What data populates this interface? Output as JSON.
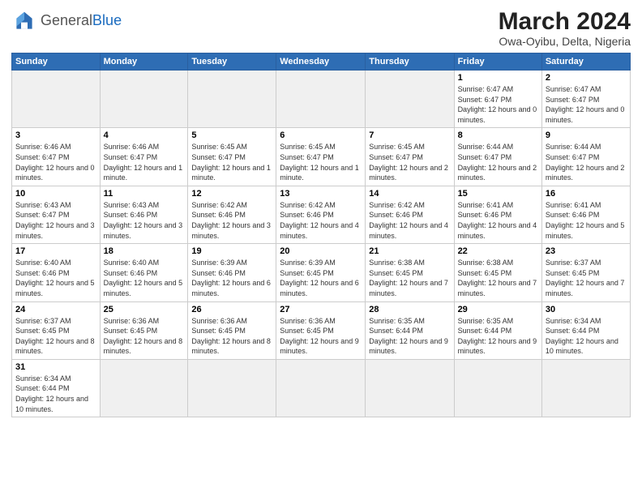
{
  "header": {
    "logo_general": "General",
    "logo_blue": "Blue",
    "month_year": "March 2024",
    "location": "Owa-Oyibu, Delta, Nigeria"
  },
  "weekdays": [
    "Sunday",
    "Monday",
    "Tuesday",
    "Wednesday",
    "Thursday",
    "Friday",
    "Saturday"
  ],
  "weeks": [
    [
      {
        "day": "",
        "info": "",
        "empty": true
      },
      {
        "day": "",
        "info": "",
        "empty": true
      },
      {
        "day": "",
        "info": "",
        "empty": true
      },
      {
        "day": "",
        "info": "",
        "empty": true
      },
      {
        "day": "",
        "info": "",
        "empty": true
      },
      {
        "day": "1",
        "info": "Sunrise: 6:47 AM\nSunset: 6:47 PM\nDaylight: 12 hours and 0 minutes.",
        "empty": false
      },
      {
        "day": "2",
        "info": "Sunrise: 6:47 AM\nSunset: 6:47 PM\nDaylight: 12 hours and 0 minutes.",
        "empty": false
      }
    ],
    [
      {
        "day": "3",
        "info": "Sunrise: 6:46 AM\nSunset: 6:47 PM\nDaylight: 12 hours and 0 minutes.",
        "empty": false
      },
      {
        "day": "4",
        "info": "Sunrise: 6:46 AM\nSunset: 6:47 PM\nDaylight: 12 hours and 1 minute.",
        "empty": false
      },
      {
        "day": "5",
        "info": "Sunrise: 6:45 AM\nSunset: 6:47 PM\nDaylight: 12 hours and 1 minute.",
        "empty": false
      },
      {
        "day": "6",
        "info": "Sunrise: 6:45 AM\nSunset: 6:47 PM\nDaylight: 12 hours and 1 minute.",
        "empty": false
      },
      {
        "day": "7",
        "info": "Sunrise: 6:45 AM\nSunset: 6:47 PM\nDaylight: 12 hours and 2 minutes.",
        "empty": false
      },
      {
        "day": "8",
        "info": "Sunrise: 6:44 AM\nSunset: 6:47 PM\nDaylight: 12 hours and 2 minutes.",
        "empty": false
      },
      {
        "day": "9",
        "info": "Sunrise: 6:44 AM\nSunset: 6:47 PM\nDaylight: 12 hours and 2 minutes.",
        "empty": false
      }
    ],
    [
      {
        "day": "10",
        "info": "Sunrise: 6:43 AM\nSunset: 6:47 PM\nDaylight: 12 hours and 3 minutes.",
        "empty": false
      },
      {
        "day": "11",
        "info": "Sunrise: 6:43 AM\nSunset: 6:46 PM\nDaylight: 12 hours and 3 minutes.",
        "empty": false
      },
      {
        "day": "12",
        "info": "Sunrise: 6:42 AM\nSunset: 6:46 PM\nDaylight: 12 hours and 3 minutes.",
        "empty": false
      },
      {
        "day": "13",
        "info": "Sunrise: 6:42 AM\nSunset: 6:46 PM\nDaylight: 12 hours and 4 minutes.",
        "empty": false
      },
      {
        "day": "14",
        "info": "Sunrise: 6:42 AM\nSunset: 6:46 PM\nDaylight: 12 hours and 4 minutes.",
        "empty": false
      },
      {
        "day": "15",
        "info": "Sunrise: 6:41 AM\nSunset: 6:46 PM\nDaylight: 12 hours and 4 minutes.",
        "empty": false
      },
      {
        "day": "16",
        "info": "Sunrise: 6:41 AM\nSunset: 6:46 PM\nDaylight: 12 hours and 5 minutes.",
        "empty": false
      }
    ],
    [
      {
        "day": "17",
        "info": "Sunrise: 6:40 AM\nSunset: 6:46 PM\nDaylight: 12 hours and 5 minutes.",
        "empty": false
      },
      {
        "day": "18",
        "info": "Sunrise: 6:40 AM\nSunset: 6:46 PM\nDaylight: 12 hours and 5 minutes.",
        "empty": false
      },
      {
        "day": "19",
        "info": "Sunrise: 6:39 AM\nSunset: 6:46 PM\nDaylight: 12 hours and 6 minutes.",
        "empty": false
      },
      {
        "day": "20",
        "info": "Sunrise: 6:39 AM\nSunset: 6:45 PM\nDaylight: 12 hours and 6 minutes.",
        "empty": false
      },
      {
        "day": "21",
        "info": "Sunrise: 6:38 AM\nSunset: 6:45 PM\nDaylight: 12 hours and 7 minutes.",
        "empty": false
      },
      {
        "day": "22",
        "info": "Sunrise: 6:38 AM\nSunset: 6:45 PM\nDaylight: 12 hours and 7 minutes.",
        "empty": false
      },
      {
        "day": "23",
        "info": "Sunrise: 6:37 AM\nSunset: 6:45 PM\nDaylight: 12 hours and 7 minutes.",
        "empty": false
      }
    ],
    [
      {
        "day": "24",
        "info": "Sunrise: 6:37 AM\nSunset: 6:45 PM\nDaylight: 12 hours and 8 minutes.",
        "empty": false
      },
      {
        "day": "25",
        "info": "Sunrise: 6:36 AM\nSunset: 6:45 PM\nDaylight: 12 hours and 8 minutes.",
        "empty": false
      },
      {
        "day": "26",
        "info": "Sunrise: 6:36 AM\nSunset: 6:45 PM\nDaylight: 12 hours and 8 minutes.",
        "empty": false
      },
      {
        "day": "27",
        "info": "Sunrise: 6:36 AM\nSunset: 6:45 PM\nDaylight: 12 hours and 9 minutes.",
        "empty": false
      },
      {
        "day": "28",
        "info": "Sunrise: 6:35 AM\nSunset: 6:44 PM\nDaylight: 12 hours and 9 minutes.",
        "empty": false
      },
      {
        "day": "29",
        "info": "Sunrise: 6:35 AM\nSunset: 6:44 PM\nDaylight: 12 hours and 9 minutes.",
        "empty": false
      },
      {
        "day": "30",
        "info": "Sunrise: 6:34 AM\nSunset: 6:44 PM\nDaylight: 12 hours and 10 minutes.",
        "empty": false
      }
    ],
    [
      {
        "day": "31",
        "info": "Sunrise: 6:34 AM\nSunset: 6:44 PM\nDaylight: 12 hours and 10 minutes.",
        "empty": false
      },
      {
        "day": "",
        "info": "",
        "empty": true
      },
      {
        "day": "",
        "info": "",
        "empty": true
      },
      {
        "day": "",
        "info": "",
        "empty": true
      },
      {
        "day": "",
        "info": "",
        "empty": true
      },
      {
        "day": "",
        "info": "",
        "empty": true
      },
      {
        "day": "",
        "info": "",
        "empty": true
      }
    ]
  ]
}
